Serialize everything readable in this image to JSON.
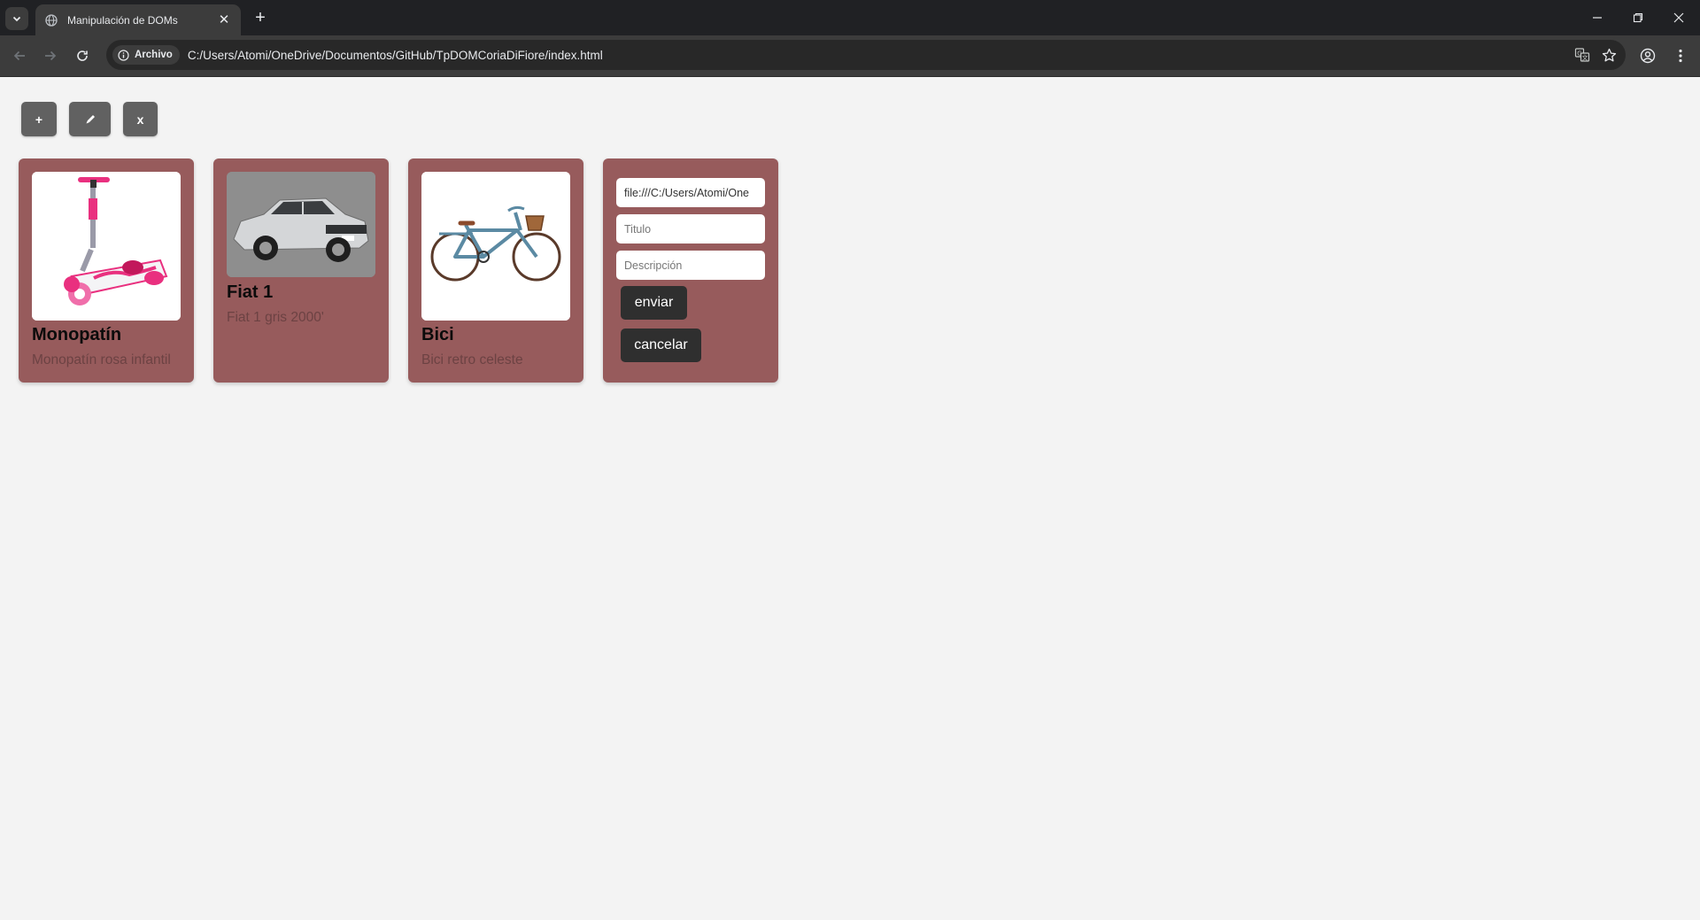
{
  "browser": {
    "tab_title": "Manipulación de DOMs",
    "new_tab_symbol": "+",
    "close_symbol": "✕",
    "security_chip": "Archivo",
    "url": "C:/Users/Atomi/OneDrive/Documentos/GitHub/TpDOMCoriaDiFiore/index.html",
    "dark_bg": "#202124",
    "toolbar_bg": "#3c3c3c"
  },
  "actions": {
    "add_label": "+",
    "edit_icon": "pencil-icon",
    "delete_label": "x",
    "button_bg": "#616161"
  },
  "cards": [
    {
      "title": "Monopatín",
      "description": "Monopatín rosa infantil",
      "image": "scooter-image"
    },
    {
      "title": "Fiat 1",
      "description": "Fiat 1 gris 2000'",
      "image": "car-image"
    },
    {
      "title": "Bici",
      "description": "Bici retro celeste",
      "image": "bicycle-image"
    }
  ],
  "form": {
    "image_value": "file:///C:/Users/Atomi/One",
    "title_placeholder": "Titulo",
    "description_placeholder": "Descripción",
    "send_label": "enviar",
    "cancel_label": "cancelar"
  },
  "colors": {
    "page_bg": "#f3f3f3",
    "card_bg": "#975b5c",
    "form_button_bg": "#2f2f2f"
  }
}
